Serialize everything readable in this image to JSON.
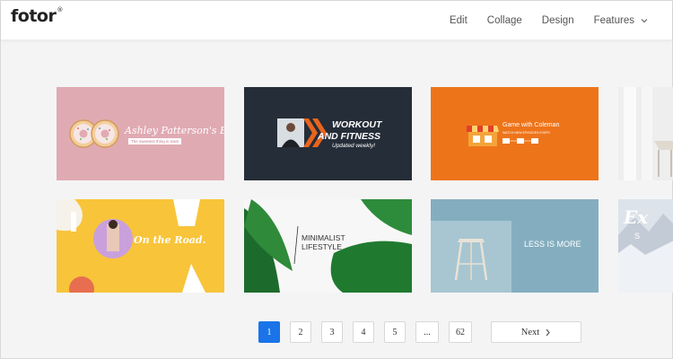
{
  "brand": {
    "logo": "fotor",
    "mark": "®"
  },
  "nav": {
    "items": [
      {
        "label": "Edit"
      },
      {
        "label": "Collage"
      },
      {
        "label": "Design"
      },
      {
        "label": "Features"
      }
    ]
  },
  "cards": [
    {
      "id": "bakery",
      "bg": "#e0aab2",
      "title": "Ashley Patterson's Bakery",
      "subtitle": "The sweetest thing in town"
    },
    {
      "id": "workout",
      "bg": "#252d38",
      "title_line1": "WORKOUT",
      "title_line2": "AND FITNESS",
      "subtitle": "Updated weekly!",
      "accent": "#e8641e"
    },
    {
      "id": "game",
      "bg": "#ee741a",
      "title": "Game with Coleman",
      "subtitle": "WATCH NEW EPISODES EVERY"
    },
    {
      "id": "interior",
      "bg": "#e7e7e7"
    },
    {
      "id": "road",
      "bg": "#f8c43a",
      "title": "On the Road."
    },
    {
      "id": "minimalist",
      "bg": "#f7f7f7",
      "title_line1": "MINIMALIST",
      "title_line2": "LIFESTYLE"
    },
    {
      "id": "less",
      "bg": "#84aebf",
      "title": "LESS IS MORE"
    },
    {
      "id": "snow",
      "bg": "#dde3ea",
      "title": "Ex",
      "subtitle": "S"
    }
  ],
  "pagination": {
    "pages": [
      "1",
      "2",
      "3",
      "4",
      "5",
      "...",
      "62"
    ],
    "active": "1",
    "next_label": "Next"
  },
  "colors": {
    "accent": "#1a73e8"
  }
}
